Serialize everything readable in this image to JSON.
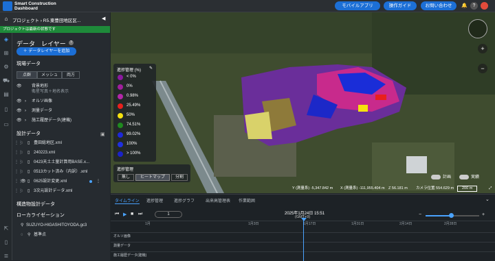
{
  "header": {
    "logo_line1": "Smart Construction",
    "logo_line2": "Dashboard",
    "mobile_app": "モバイルアプリ",
    "guide": "操作ガイド",
    "contact": "お問い合わせ"
  },
  "project": {
    "breadcrumb": "プロジェクト › R5.東豊田地区区...",
    "status": "プロジェクトは最新の状態です"
  },
  "panel": {
    "title": "データ　レイヤー",
    "add_button": "＋ データレイヤーを追加",
    "survey_section": "現場データ",
    "tabs": [
      "点群",
      "メッシュ",
      "両方"
    ],
    "terrain": "背景地形",
    "terrain_sub": "衛星写真＋地名表示",
    "ortho": "オルソ画像",
    "survey_data": "測量データ",
    "construction_history": "施工履歴データ(建機)",
    "design_section": "設計データ",
    "design_files": [
      "豊田総地区.xml",
      "240223.xml",
      "0423天土土量計算用BASE.x...",
      "0513カット済み（内訳）.xml",
      "0625設計変更.xml",
      "3次元設計データ.xml"
    ],
    "structure_section": "構造物設計データ",
    "localization_section": "ローカライゼーション",
    "localization_file": "SUZUYO-HIGASHITOYODA.gc3",
    "reference_point": "基準点"
  },
  "legend": {
    "title": "進捗管理 (%)",
    "items": [
      {
        "label": "< 0%",
        "color": "#8b1aa0"
      },
      {
        "label": "0%",
        "color": "#a01f9c"
      },
      {
        "label": "0.98%",
        "color": "#b327a8"
      },
      {
        "label": "25.49%",
        "color": "#e8201d"
      },
      {
        "label": "50%",
        "color": "#f5e20f"
      },
      {
        "label": "74.51%",
        "color": "#1f8a1f"
      },
      {
        "label": "99.02%",
        "color": "#1d28d8"
      },
      {
        "label": "100%",
        "color": "#1f30e0"
      },
      {
        "label": "> 100%",
        "color": "#1a22c8"
      }
    ]
  },
  "mode": {
    "title": "進捗管理",
    "options": [
      "無し",
      "ヒートマップ",
      "分割"
    ]
  },
  "map_controls": {
    "plan": "計画",
    "actual": "実績",
    "y_coord": "Y (測量系) -5,347.842 m",
    "x_coord": "X (測量系) -111,955.404 m",
    "z_coord": "Z 56.181 m",
    "camera": "カメラ位置 554.629 m",
    "scale": "200 m"
  },
  "timeline": {
    "tabs": [
      "タイムライン",
      "進捗管理",
      "進捗グラフ",
      "出来高管理表",
      "作業範囲"
    ],
    "date": "2025年1月24日 15:51",
    "timezone": "(GMT+9)",
    "speed": "1",
    "months": [
      "1月",
      "1月3日",
      "1月17日",
      "1月31日",
      "2月14日",
      "2月28日"
    ],
    "tracks": [
      "オルソ画像",
      "測量データ",
      "施工履歴データ(建機)"
    ]
  }
}
